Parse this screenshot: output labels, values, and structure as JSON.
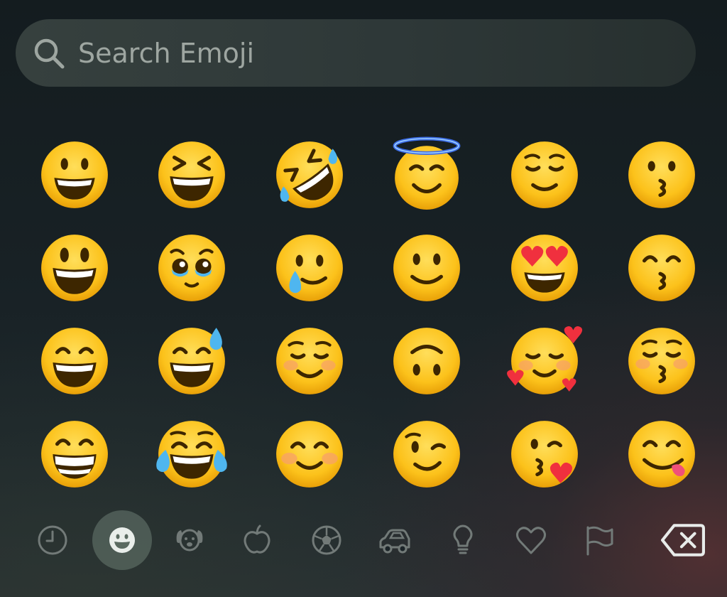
{
  "search": {
    "placeholder": "Search Emoji",
    "value": ""
  },
  "emoji_grid": {
    "rows": [
      [
        "grinning-face",
        "grinning-squinting-face",
        "rolling-on-the-floor-laughing",
        "smiling-face-with-halo",
        "relieved-face",
        "kissing-face"
      ],
      [
        "grinning-face-with-big-eyes",
        "face-holding-back-tears",
        "smiling-face-with-tear",
        "slightly-smiling-face",
        "smiling-face-with-heart-eyes",
        "kissing-face-with-smiling-eyes"
      ],
      [
        "grinning-face-with-smiling-eyes",
        "grinning-face-with-sweat",
        "smiling-face",
        "upside-down-face",
        "smiling-face-with-hearts",
        "kissing-face-with-closed-eyes"
      ],
      [
        "beaming-face-with-smiling-eyes",
        "face-with-tears-of-joy",
        "smiling-face-with-smiling-eyes",
        "winking-face",
        "face-blowing-a-kiss",
        "face-savoring-food"
      ]
    ]
  },
  "categories": {
    "active": "smileys",
    "items": [
      {
        "id": "recent",
        "icon": "clock-icon"
      },
      {
        "id": "smileys",
        "icon": "smiley-icon"
      },
      {
        "id": "animals",
        "icon": "dog-icon"
      },
      {
        "id": "food",
        "icon": "apple-icon"
      },
      {
        "id": "activity",
        "icon": "soccer-ball-icon"
      },
      {
        "id": "travel",
        "icon": "car-icon"
      },
      {
        "id": "objects",
        "icon": "lightbulb-icon"
      },
      {
        "id": "symbols",
        "icon": "heart-icon"
      },
      {
        "id": "flags",
        "icon": "flag-icon"
      }
    ]
  },
  "delete": {
    "icon": "delete-backspace-icon"
  },
  "colors": {
    "emoji_yellow": "#fcc21b",
    "emoji_yellow_light": "#ffde5a",
    "emoji_shade": "#e8a008",
    "feature_brown": "#3d2600",
    "icon_gray": "#727a78",
    "delete_white": "#e8ecea",
    "search_text": "#9ea6a1"
  }
}
